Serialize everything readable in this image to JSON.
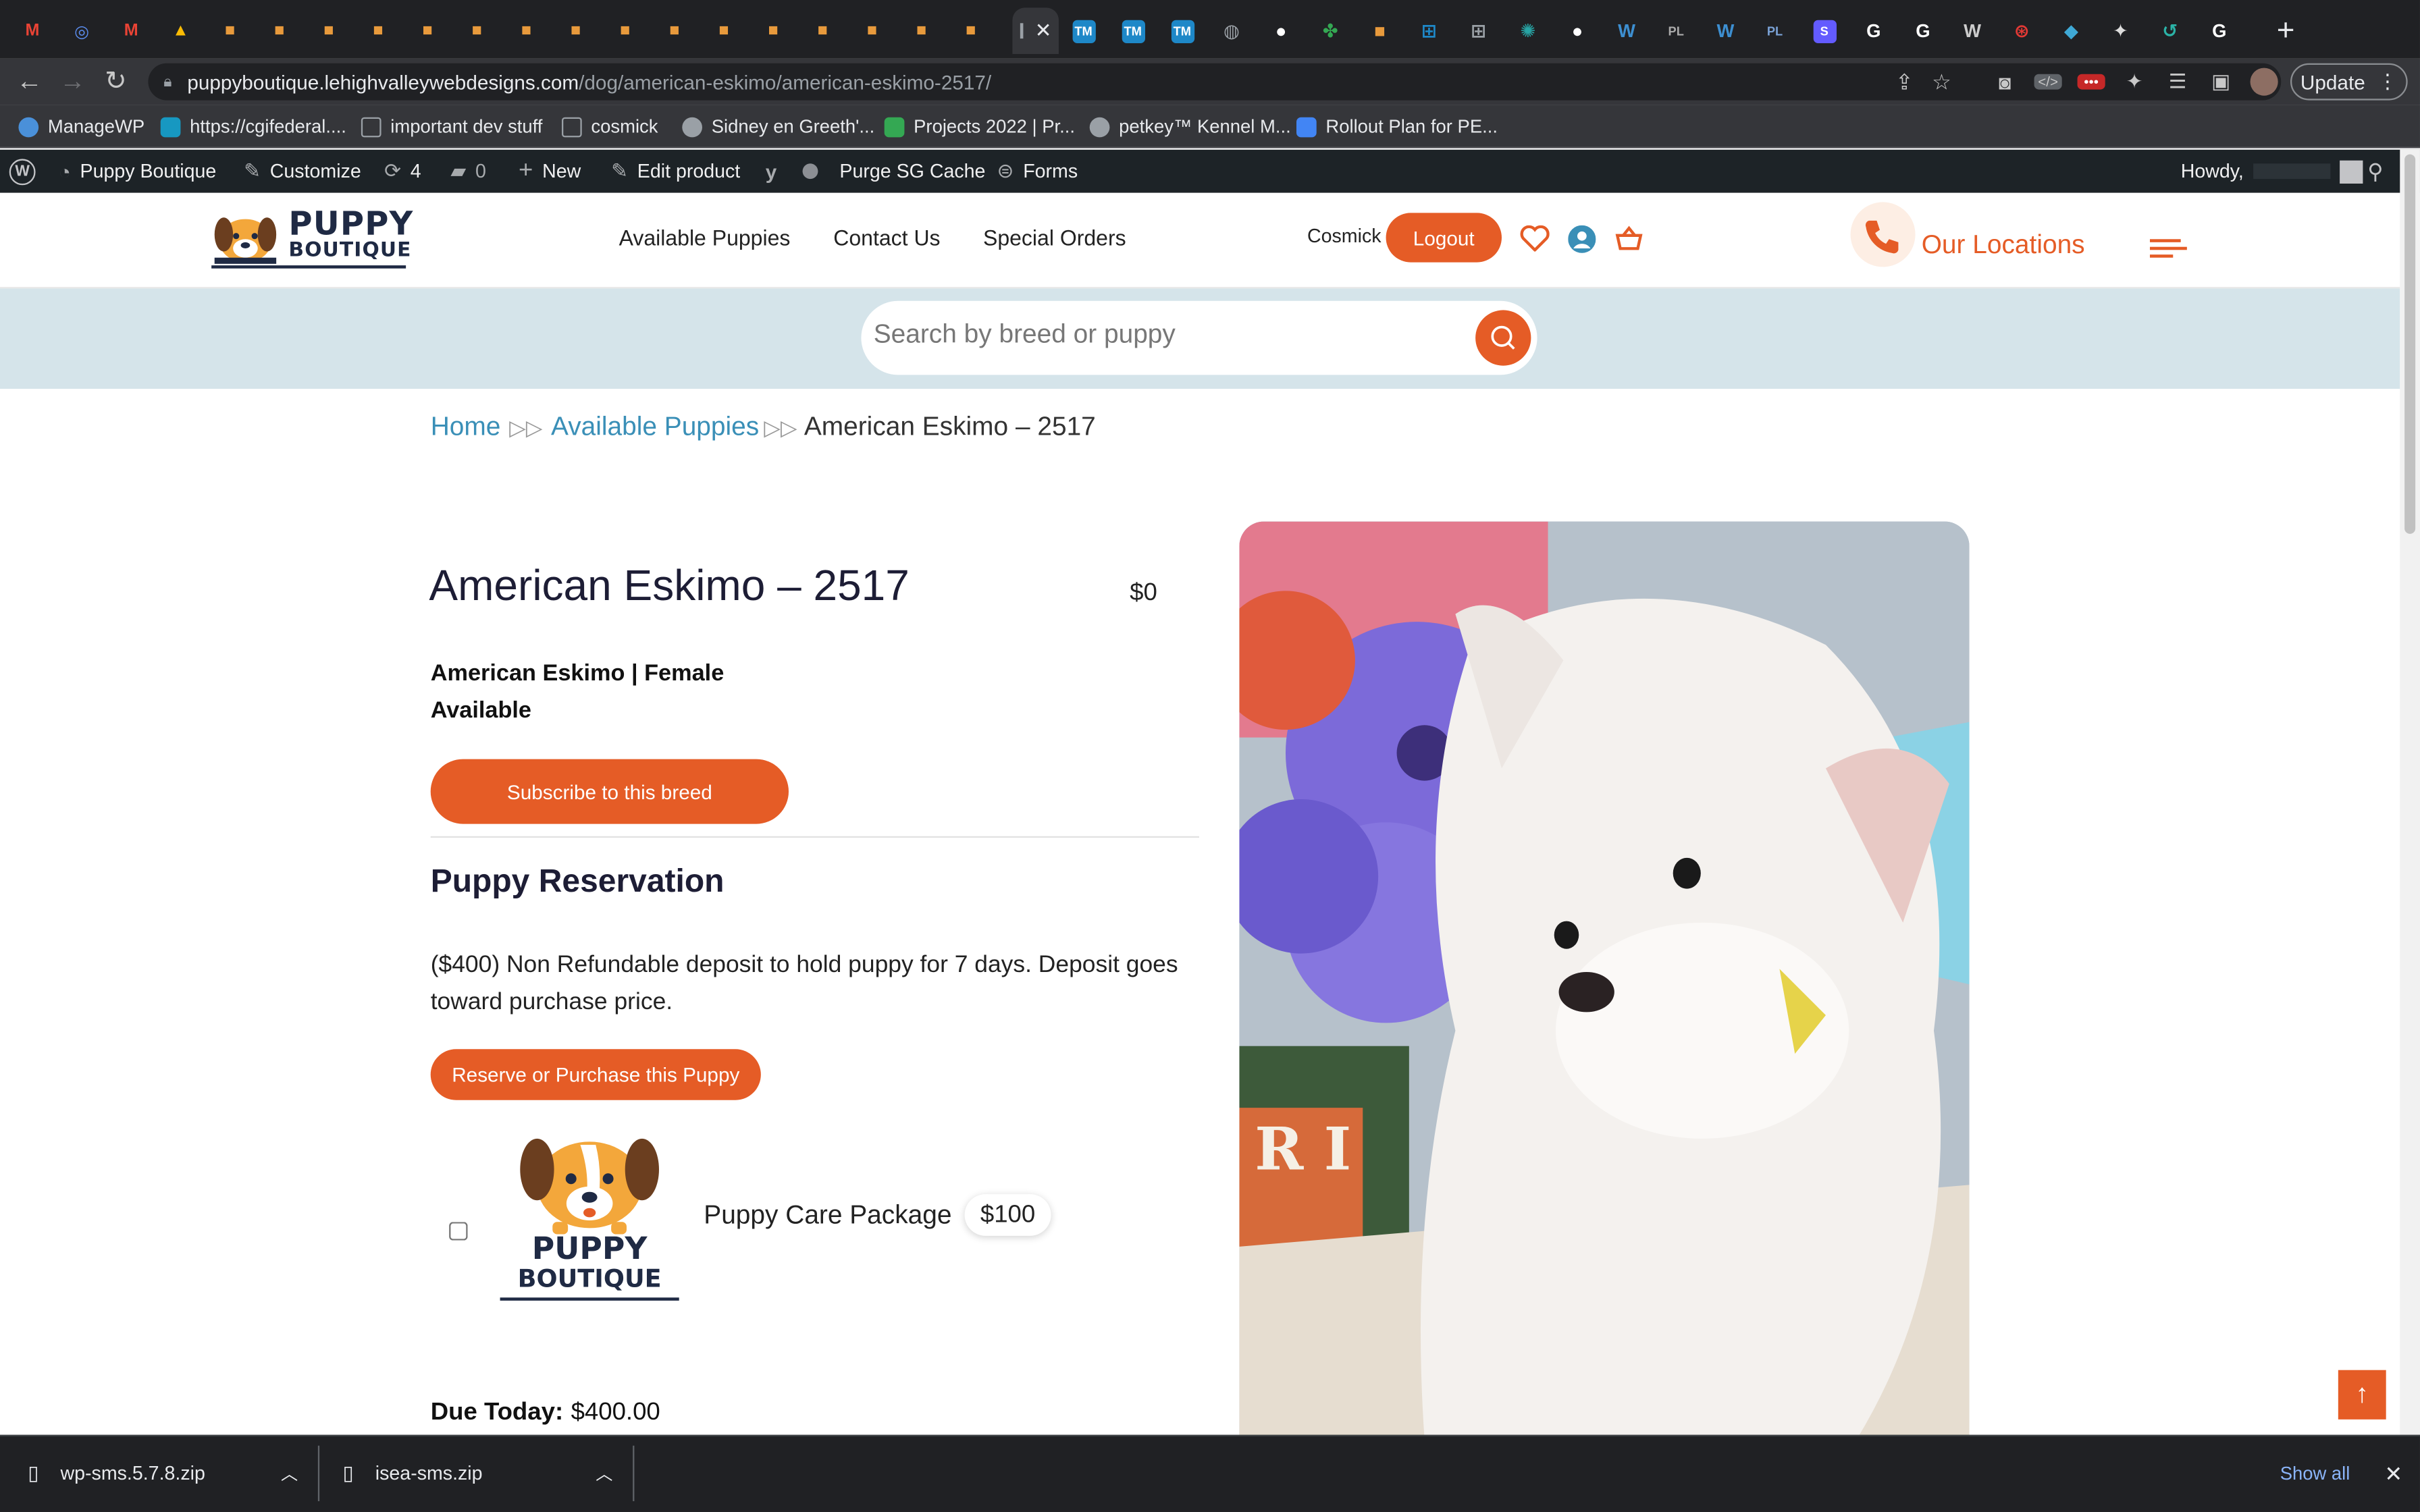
{
  "browser": {
    "url_domain": "puppyboutique.lehighvalleywebdesigns.com",
    "url_path": "/dog/american-eskimo/american-eskimo-2517/",
    "update_label": "Update",
    "bookmarks": [
      {
        "label": "ManageWP",
        "icon": "managewp-icon",
        "color": "#4a90d9"
      },
      {
        "label": "https://cgifederal....",
        "icon": "salesforce-icon",
        "color": "#1798c1"
      },
      {
        "label": "important dev stuff",
        "icon": "folder-icon",
        "color": "#9aa0a6"
      },
      {
        "label": "cosmick",
        "icon": "folder-icon",
        "color": "#9aa0a6"
      },
      {
        "label": "Sidney en Greeth'...",
        "icon": "globe-icon",
        "color": "#9aa0a6"
      },
      {
        "label": "Projects 2022 | Pr...",
        "icon": "diamond-icon",
        "color": "#34a853"
      },
      {
        "label": "petkey™ Kennel M...",
        "icon": "globe-icon",
        "color": "#9aa0a6"
      },
      {
        "label": "Rollout Plan for PE...",
        "icon": "docs-icon",
        "color": "#4285f4"
      }
    ],
    "tabs": [
      {
        "icon": "gmail-icon",
        "color": "#ea4335",
        "glyph": "M"
      },
      {
        "icon": "target-icon",
        "color": "#5b8def",
        "glyph": "◎"
      },
      {
        "icon": "gmail-icon",
        "color": "#ea4335",
        "glyph": "M"
      },
      {
        "icon": "drive-icon",
        "color": "#fbbc04",
        "glyph": "▲"
      },
      {
        "icon": "puppy-favicon",
        "color": "#e89a3c",
        "glyph": "■"
      },
      {
        "icon": "puppy-favicon",
        "color": "#e89a3c",
        "glyph": "■"
      },
      {
        "icon": "puppy-favicon",
        "color": "#e89a3c",
        "glyph": "■"
      },
      {
        "icon": "puppy-favicon",
        "color": "#e89a3c",
        "glyph": "■"
      },
      {
        "icon": "puppy-favicon",
        "color": "#e89a3c",
        "glyph": "■"
      },
      {
        "icon": "puppy-favicon",
        "color": "#e89a3c",
        "glyph": "■"
      },
      {
        "icon": "puppy-favicon",
        "color": "#e89a3c",
        "glyph": "■"
      },
      {
        "icon": "puppy-favicon",
        "color": "#e89a3c",
        "glyph": "■"
      },
      {
        "icon": "puppy-favicon",
        "color": "#e89a3c",
        "glyph": "■"
      },
      {
        "icon": "puppy-favicon",
        "color": "#e89a3c",
        "glyph": "■"
      },
      {
        "icon": "puppy-favicon",
        "color": "#e89a3c",
        "glyph": "■"
      },
      {
        "icon": "puppy-favicon",
        "color": "#e89a3c",
        "glyph": "■"
      },
      {
        "icon": "puppy-favicon",
        "color": "#e89a3c",
        "glyph": "■"
      },
      {
        "icon": "puppy-favicon",
        "color": "#e89a3c",
        "glyph": "■"
      },
      {
        "icon": "puppy-favicon",
        "color": "#e89a3c",
        "glyph": "■"
      },
      {
        "icon": "puppy-favicon",
        "color": "#e89a3c",
        "glyph": "■"
      }
    ],
    "tabs_right": [
      {
        "icon": "tm-icon",
        "color": "#1e88c8",
        "glyph": "TM"
      },
      {
        "icon": "tm-icon",
        "color": "#1e88c8",
        "glyph": "TM"
      },
      {
        "icon": "tm-icon",
        "color": "#1e88c8",
        "glyph": "TM"
      },
      {
        "icon": "globe-icon",
        "color": "#9aa0a6",
        "glyph": "◍"
      },
      {
        "icon": "github-icon",
        "color": "#ffffff",
        "glyph": "●"
      },
      {
        "icon": "clover-icon",
        "color": "#34a853",
        "glyph": "✤"
      },
      {
        "icon": "puppy-favicon",
        "color": "#e89a3c",
        "glyph": "■"
      },
      {
        "icon": "cart-icon",
        "color": "#1e88c8",
        "glyph": "⊞"
      },
      {
        "icon": "cart-icon",
        "color": "#9aa0a6",
        "glyph": "⊞"
      },
      {
        "icon": "octopus-icon",
        "color": "#27a4a4",
        "glyph": "✺"
      },
      {
        "icon": "github-icon",
        "color": "#ffffff",
        "glyph": "●"
      },
      {
        "icon": "wordpress-icon",
        "color": "#3d8fd1",
        "glyph": "W"
      },
      {
        "icon": "pl-icon",
        "color": "#aaaaaa",
        "glyph": "PL"
      },
      {
        "icon": "wordpress-icon",
        "color": "#3d8fd1",
        "glyph": "W"
      },
      {
        "icon": "pl-icon",
        "color": "#7aa2d6",
        "glyph": "PL"
      },
      {
        "icon": "stripe-icon",
        "color": "#635bff",
        "glyph": "S"
      },
      {
        "icon": "google-icon",
        "color": "#ffffff",
        "glyph": "G"
      },
      {
        "icon": "google-icon",
        "color": "#ffffff",
        "glyph": "G"
      },
      {
        "icon": "wordpress-icon",
        "color": "#cccccc",
        "glyph": "W"
      },
      {
        "icon": "lifebuoy-icon",
        "color": "#e53935",
        "glyph": "⊛"
      },
      {
        "icon": "bird-icon",
        "color": "#3fa9d6",
        "glyph": "◆"
      },
      {
        "icon": "puzzle-icon",
        "color": "#dddddd",
        "glyph": "✦"
      },
      {
        "icon": "swirl-icon",
        "color": "#2bb3a7",
        "glyph": "↺"
      },
      {
        "icon": "google-icon",
        "color": "#ffffff",
        "glyph": "G"
      }
    ]
  },
  "adminbar": {
    "site_name": "Puppy Boutique",
    "customize": "Customize",
    "updates_count": "4",
    "comments_count": "0",
    "new_label": "New",
    "edit_product": "Edit product",
    "purge_cache": "Purge SG Cache",
    "forms": "Forms",
    "howdy": "Howdy,"
  },
  "site": {
    "logo_line1": "PUPPY",
    "logo_line2": "BOUTIQUE",
    "nav": [
      "Available Puppies",
      "Contact Us",
      "Special Orders"
    ],
    "username": "Cosmick",
    "logout_label": "Logout",
    "locations_label": "Our Locations",
    "search_placeholder": "Search by breed or puppy",
    "accent": "#e55c26",
    "link_color": "#3a8fb7"
  },
  "breadcrumb": {
    "home": "Home",
    "available": "Available Puppies",
    "current": "American Eskimo – 2517"
  },
  "product": {
    "title": "American Eskimo – 2517",
    "price": "$0",
    "meta": "American Eskimo | Female",
    "status": "Available",
    "subscribe_label": "Subscribe to this breed",
    "reservation_heading": "Puppy Reservation",
    "reservation_text": "($400) Non Refundable deposit to hold puppy for 7 days. Deposit goes toward purchase price.",
    "reserve_label": "Reserve or Purchase this Puppy",
    "addon_name": "Puppy Care Package",
    "addon_price": "$100",
    "addon_logo_line1": "PUPPY",
    "addon_logo_line2": "BOUTIQUE",
    "due_label": "Due Today:",
    "due_value": "$400.00",
    "photo_letters": "R I"
  },
  "downloads": {
    "items": [
      "wp-sms.5.7.8.zip",
      "isea-sms.zip"
    ],
    "show_all": "Show all"
  }
}
